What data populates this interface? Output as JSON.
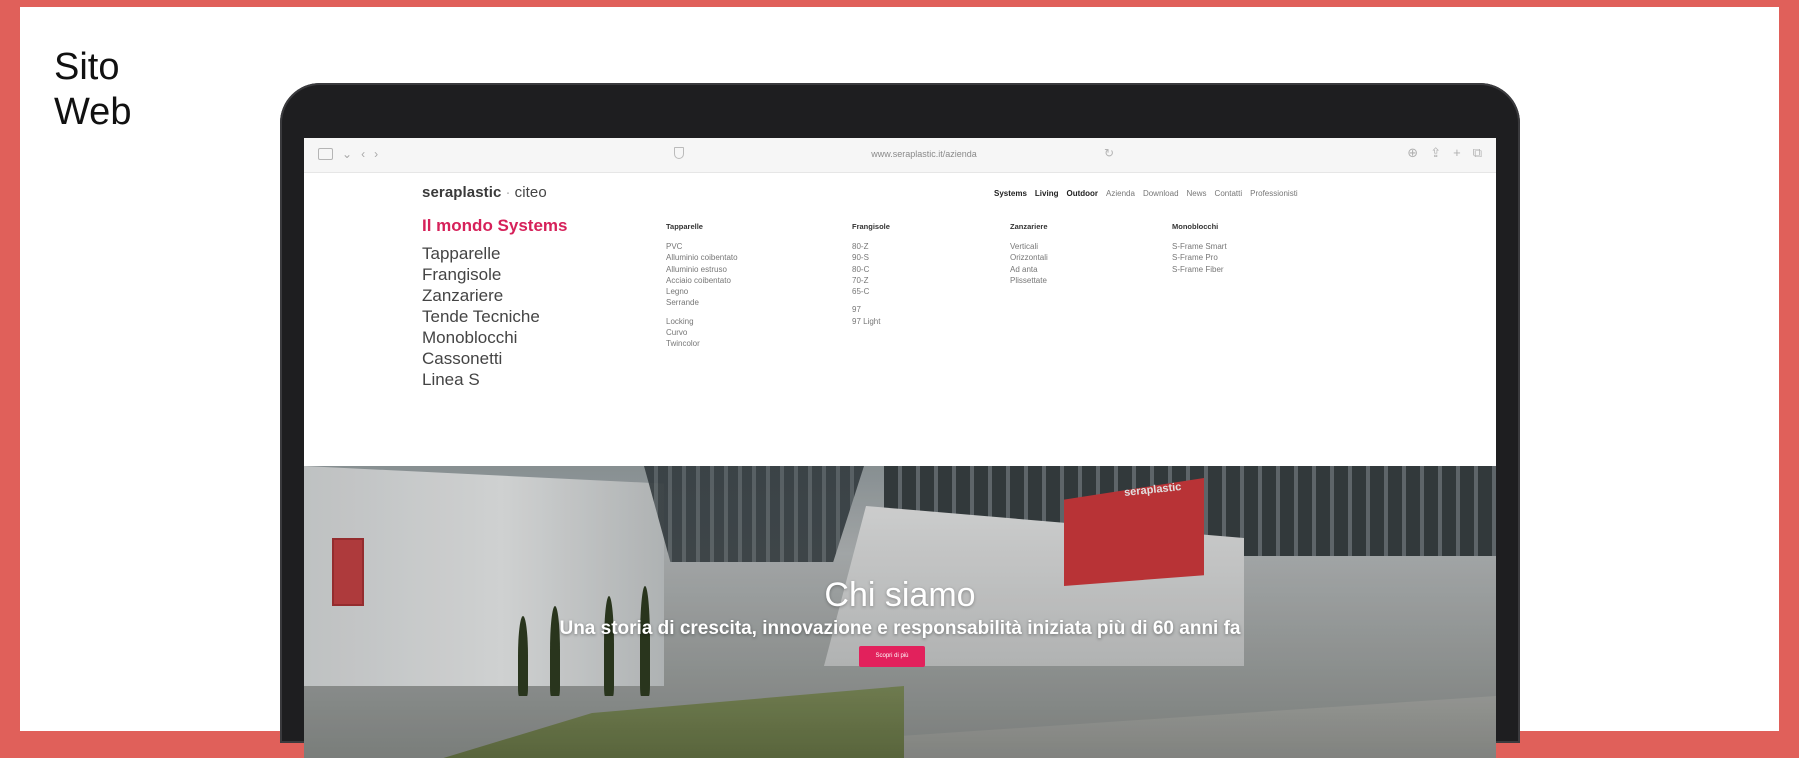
{
  "section_title": [
    "Sito",
    "Web"
  ],
  "browser": {
    "url": "www.seraplastic.it/azienda"
  },
  "site": {
    "logo": "seraplastic",
    "logo_sep": "·",
    "logo_brand": "citeo",
    "top_nav": [
      {
        "label": "Systems",
        "bold": true
      },
      {
        "label": "Living",
        "bold": true
      },
      {
        "label": "Outdoor",
        "bold": true
      },
      {
        "label": "Azienda",
        "bold": false
      },
      {
        "label": "Download",
        "bold": false
      },
      {
        "label": "News",
        "bold": false
      },
      {
        "label": "Contatti",
        "bold": false
      },
      {
        "label": "Professionisti",
        "bold": false
      }
    ]
  },
  "menu": {
    "heading": "Il mondo Systems",
    "categories": [
      "Tapparelle",
      "Frangisole",
      "Zanzariere",
      "Tende Tecniche",
      "Monoblocchi",
      "Cassonetti",
      "Linea S"
    ],
    "columns": [
      {
        "title": "Tapparelle",
        "items": [
          "PVC",
          "Alluminio coibentato",
          "Alluminio estruso",
          "Acciaio coibentato",
          "Legno",
          "Serrande"
        ],
        "items2": [
          "Locking",
          "Curvo",
          "Twincolor"
        ]
      },
      {
        "title": "Frangisole",
        "items": [
          "80-Z",
          "90-S",
          "80-C",
          "70-Z",
          "65-C"
        ],
        "items2": [
          "97",
          "97 Light"
        ]
      },
      {
        "title": "Zanzariere",
        "items": [
          "Verticali",
          "Orizzontali",
          "Ad anta",
          "Plissettate"
        ],
        "items2": []
      },
      {
        "title": "Monoblocchi",
        "items": [
          "S-Frame Smart",
          "S-Frame Pro",
          "S-Frame Fiber"
        ],
        "items2": []
      }
    ]
  },
  "hero": {
    "title": "Chi siamo",
    "subtitle": "Una storia di crescita, innovazione e responsabilità iniziata più di 60 anni fa",
    "cta": "Scopri di più",
    "sign": "seraplastic"
  }
}
